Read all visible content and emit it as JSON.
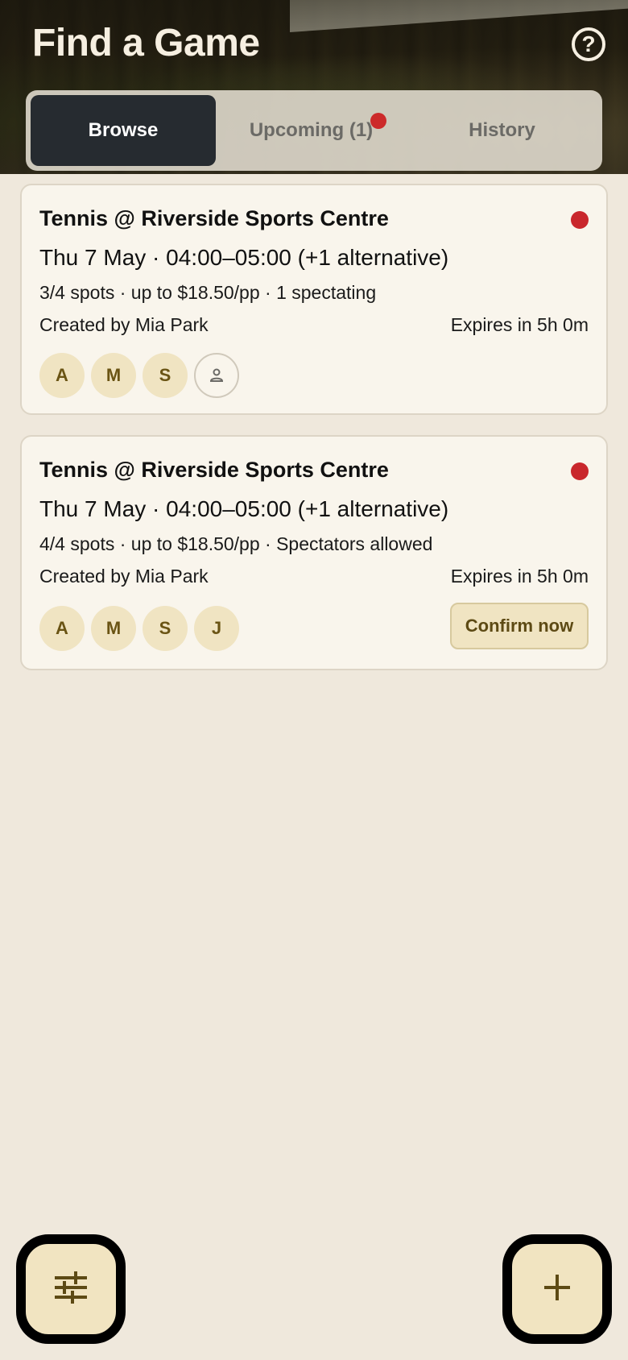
{
  "header": {
    "title": "Find a Game",
    "help_icon": "help-circle-icon"
  },
  "tabs": [
    {
      "label": "Browse",
      "active": true
    },
    {
      "label": "Upcoming (1)",
      "active": false,
      "has_notification_dot": true
    },
    {
      "label": "History",
      "active": false
    }
  ],
  "games": [
    {
      "venue": "Tennis @ Riverside Sports Centre",
      "when": "Thu 7 May · 04:00–05:00 (+1 alternative)",
      "meta": "3/4 spots · up to $18.50/pp · 1 spectating",
      "creator": "Created by Mia Park",
      "expires": "Expires in 5h 0m",
      "avatars": [
        "A",
        "M",
        "S"
      ],
      "has_spectator_icon": true
    },
    {
      "venue": "Tennis @ Riverside Sports Centre",
      "when": "Thu 7 May · 04:00–05:00 (+1 alternative)",
      "meta": "4/4 spots · up to $18.50/pp · Spectators allowed",
      "creator": "Created by Mia Park",
      "expires": "Expires in 5h 0m",
      "avatars": [
        "A",
        "M",
        "S",
        "J"
      ],
      "action_label": "Confirm now"
    }
  ],
  "fabs": {
    "filter_icon": "filter-sliders-icon",
    "create_icon": "plus-icon"
  },
  "colors": {
    "accent_dot": "#c9272c",
    "active_tab_bg": "#262b30",
    "avatar_bg": "#f0e4c2"
  }
}
